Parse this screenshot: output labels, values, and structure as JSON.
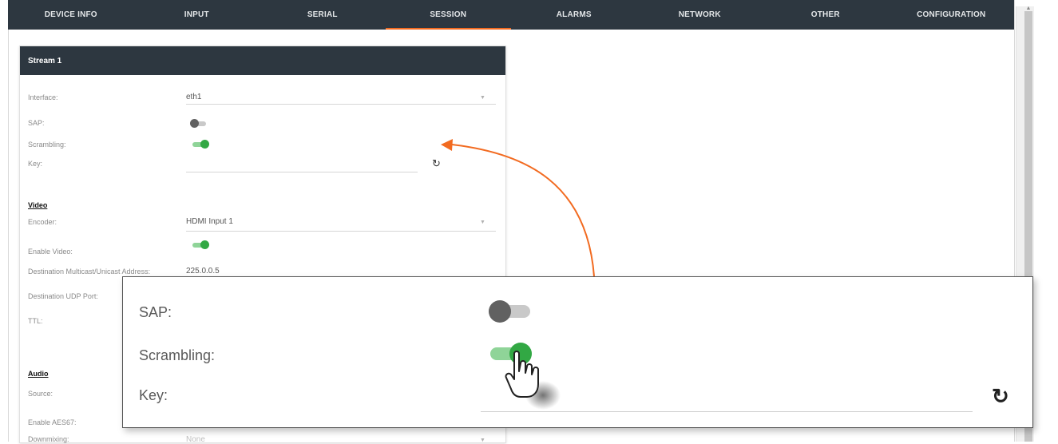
{
  "nav": {
    "tabs": [
      {
        "label": "DEVICE INFO"
      },
      {
        "label": "INPUT"
      },
      {
        "label": "SERIAL"
      },
      {
        "label": "SESSION"
      },
      {
        "label": "ALARMS"
      },
      {
        "label": "NETWORK"
      },
      {
        "label": "OTHER"
      },
      {
        "label": "CONFIGURATION"
      }
    ],
    "active": "SESSION"
  },
  "stream": {
    "title": "Stream 1",
    "interface": {
      "label": "Interface:",
      "value": "eth1"
    },
    "sap": {
      "label": "SAP:",
      "enabled": false
    },
    "scrambling": {
      "label": "Scrambling:",
      "enabled": true
    },
    "key": {
      "label": "Key:",
      "value": ""
    },
    "video": {
      "title": "Video",
      "encoder": {
        "label": "Encoder:",
        "value": "HDMI Input 1"
      },
      "enable_video": {
        "label": "Enable Video:",
        "enabled": true
      },
      "dest_address": {
        "label": "Destination Multicast/Unicast Address:",
        "value": "225.0.0.5"
      },
      "dest_port": {
        "label": "Destination UDP Port:"
      },
      "ttl": {
        "label": "TTL:"
      }
    },
    "audio": {
      "title": "Audio",
      "source": {
        "label": "Source:"
      },
      "enable_aes67": {
        "label": "Enable AES67:"
      },
      "downmixing": {
        "label": "Downmixing:",
        "value": "None"
      }
    }
  },
  "callout": {
    "sap_label": "SAP:",
    "scrambling_label": "Scrambling:",
    "key_label": "Key:"
  },
  "colors": {
    "nav_bg": "#2d3740",
    "accent": "#f26b21",
    "toggle_on": "#32a844",
    "toggle_off": "#616161"
  },
  "icons": [
    "refresh-icon",
    "pointer-hand-icon",
    "dropdown-caret-icon"
  ]
}
